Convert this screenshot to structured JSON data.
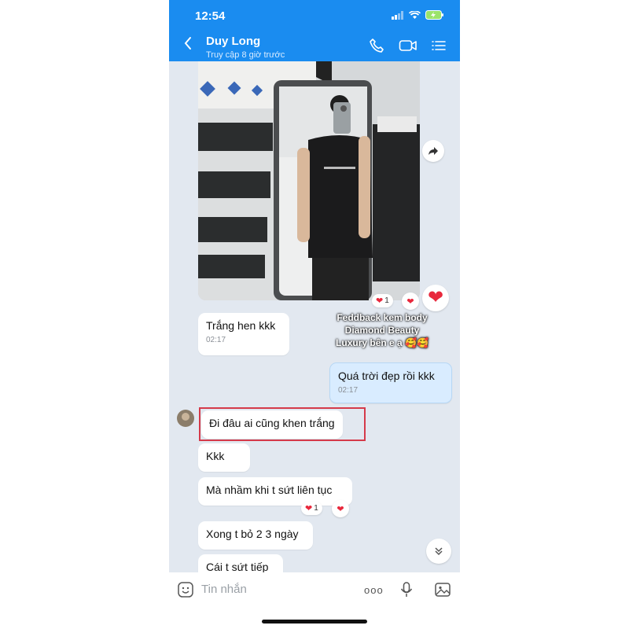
{
  "status_bar": {
    "time": "12:54"
  },
  "header": {
    "contact_name": "Duy Long",
    "last_seen": "Truy cập 8 giờ trước",
    "icons": [
      "back-icon",
      "phone-icon",
      "video-call-icon",
      "menu-icon"
    ]
  },
  "colors": {
    "header_bg": "#1a8cf0",
    "chat_bg": "#e2e8f0",
    "my_bubble": "#d9ecff",
    "highlight": "#d53a4a",
    "heart": "#e8283c"
  },
  "photo_message": {
    "caption": [
      "Feddback kem body",
      "Diamond Beauty",
      "Luxury bên e ạ 🥰🥰"
    ],
    "reaction_count": "1",
    "reactions": [
      "heart",
      "heart",
      "heart"
    ]
  },
  "messages": [
    {
      "text": "Trắng hen kkk",
      "time": "02:17",
      "from": "them"
    },
    {
      "text": "Quá trời đẹp rồi kkk",
      "time": "02:17",
      "from": "me"
    },
    {
      "text": "Đi đâu ai cũng khen trắng",
      "from": "them",
      "highlighted": true
    },
    {
      "text": "Kkk",
      "from": "them"
    },
    {
      "text": "Mà nhầm khi t sứt liên tục",
      "from": "them",
      "reaction_count": "1"
    },
    {
      "text": "Xong t bỏ 2 3 ngày",
      "from": "them"
    },
    {
      "text": "Cái t sứt tiếp",
      "from": "them"
    }
  ],
  "input": {
    "placeholder": "Tin nhắn",
    "more": "ooo"
  }
}
